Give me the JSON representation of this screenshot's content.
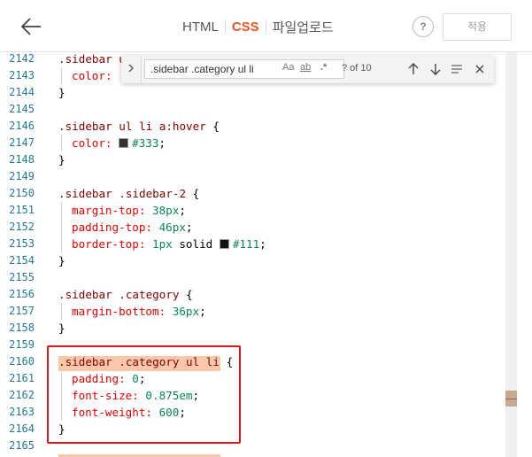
{
  "header": {
    "tabs": [
      {
        "label": "HTML",
        "active": false
      },
      {
        "label": "CSS",
        "active": true
      },
      {
        "label": "파일업로드",
        "active": false
      }
    ],
    "help_label": "?",
    "apply_label": "적용",
    "accent_color": "#f4511e"
  },
  "find": {
    "query": ".sidebar .category ul li",
    "match_case_label": "Aa",
    "whole_word_label": "ab",
    "regex_label": ".*",
    "count": "? of 10"
  },
  "code": {
    "line_numbers": [
      "2142",
      "2143",
      "2144",
      "2145",
      "2146",
      "2147",
      "2148",
      "2149",
      "2150",
      "2151",
      "2152",
      "2153",
      "2154",
      "2155",
      "2156",
      "2157",
      "2158",
      "2159",
      "2160",
      "2161",
      "2162",
      "2163",
      "2164",
      "2165"
    ],
    "l2142_sel": ".sidebar u",
    "l2143_prop": "color:",
    "l2144": "}",
    "l2146_sel": ".sidebar ul li a:hover",
    "l2146_brace": " {",
    "l2147_prop": "color:",
    "l2147_val": "#333",
    "l2147_semi": ";",
    "l2148": "}",
    "l2150_sel": ".sidebar .sidebar-2",
    "l2150_brace": " {",
    "l2151_prop": "margin-top:",
    "l2151_val": " 38px",
    "l2152_prop": "padding-top:",
    "l2152_val": " 46px",
    "l2153_prop": "border-top:",
    "l2153_val_num": " 1px",
    "l2153_val_kw": " solid ",
    "l2153_val_color": "#111",
    "l2154": "}",
    "l2156_sel": ".sidebar .category",
    "l2156_brace": " {",
    "l2157_prop": "margin-bottom:",
    "l2157_val": " 36px",
    "l2158": "}",
    "l2160_sel": ".sidebar .category ul li",
    "l2160_brace": " {",
    "l2161_prop": "padding:",
    "l2161_val": " 0",
    "l2162_prop": "font-size:",
    "l2162_val": " 0.875em",
    "l2163_prop": "font-weight:",
    "l2163_val": " 600",
    "l2164": "}",
    "semi": ";"
  },
  "colors": {
    "swatch_333": "#333333",
    "swatch_111": "#111111",
    "highlight": "#f8c8a8",
    "annotation_box": "#e1181b"
  }
}
